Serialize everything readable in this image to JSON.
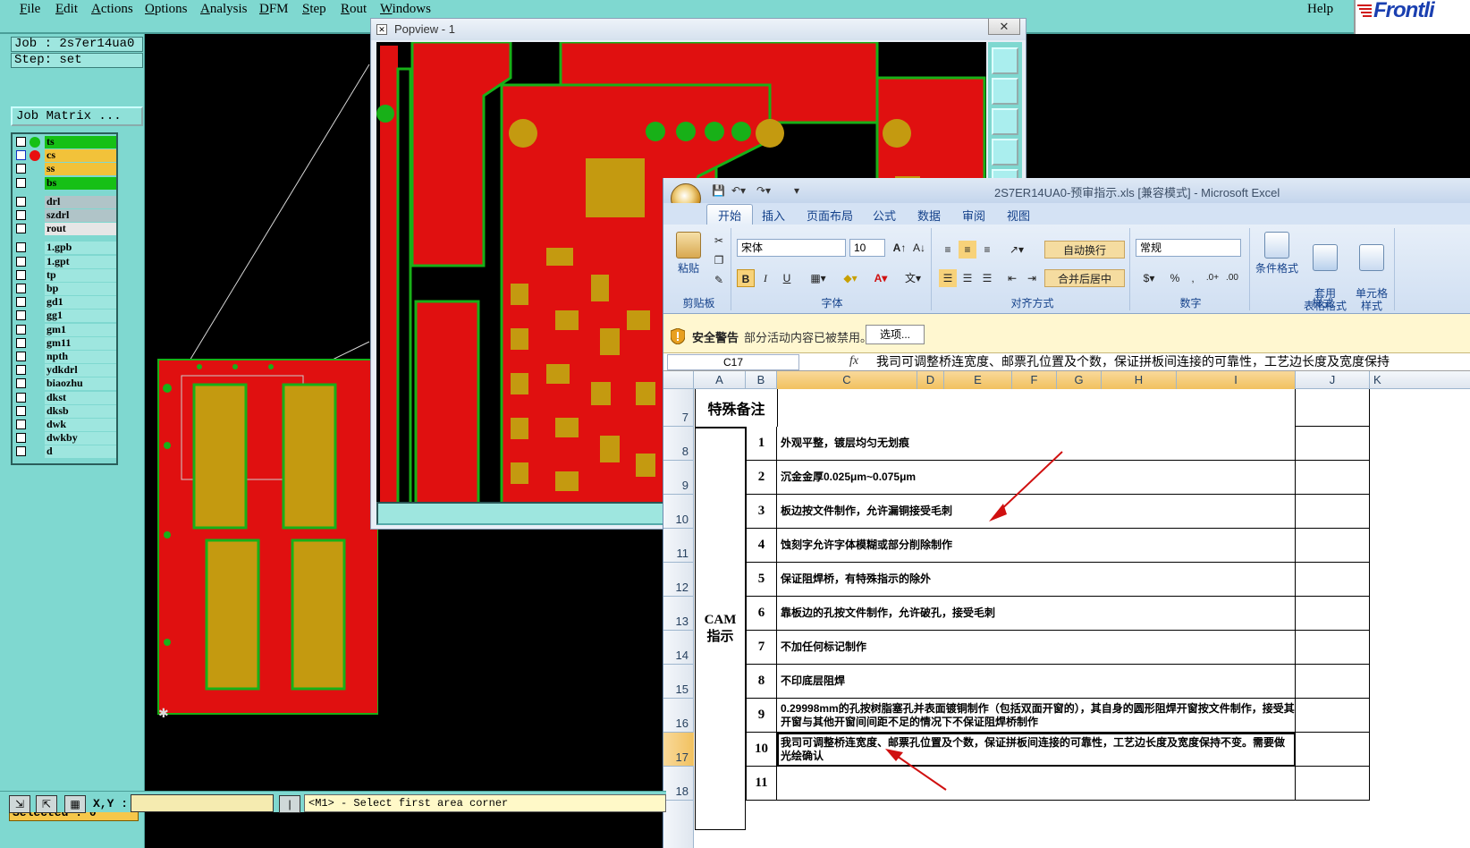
{
  "menubar": {
    "items": [
      "File",
      "Edit",
      "Actions",
      "Options",
      "Analysis",
      "DFM",
      "Step",
      "Rout",
      "Windows"
    ],
    "help": "Help",
    "logo_text": "Frontli"
  },
  "leftpanel": {
    "job": "Job : 2s7er14ua0",
    "step": "Step: set",
    "job_matrix": "Job Matrix ...",
    "layers": [
      {
        "name": "ts",
        "color": "#16c016",
        "dot": "#16c016"
      },
      {
        "name": "cs",
        "color": "#f2c23a",
        "dot": "#e81010",
        "active": true
      },
      {
        "name": "ss",
        "color": "#f2c23a"
      },
      {
        "name": "bs",
        "color": "#16c016"
      },
      {
        "name": "drl",
        "color": "#b0c4c8"
      },
      {
        "name": "szdrl",
        "color": "#b0c4c8"
      },
      {
        "name": "rout",
        "color": "#e6e6e6"
      },
      {
        "name": "1.gpb",
        "color": "#9ee6df"
      },
      {
        "name": "1.gpt",
        "color": "#9ee6df"
      },
      {
        "name": "tp",
        "color": "#9ee6df"
      },
      {
        "name": "bp",
        "color": "#9ee6df"
      },
      {
        "name": "gd1",
        "color": "#9ee6df"
      },
      {
        "name": "gg1",
        "color": "#9ee6df"
      },
      {
        "name": "gm1",
        "color": "#9ee6df"
      },
      {
        "name": "gm11",
        "color": "#9ee6df"
      },
      {
        "name": "npth",
        "color": "#9ee6df"
      },
      {
        "name": "ydkdrl",
        "color": "#9ee6df"
      },
      {
        "name": "biaozhu",
        "color": "#9ee6df"
      },
      {
        "name": "dkst",
        "color": "#9ee6df"
      },
      {
        "name": "dksb",
        "color": "#9ee6df"
      },
      {
        "name": "dwk",
        "color": "#9ee6df"
      },
      {
        "name": "dwkby",
        "color": "#9ee6df"
      },
      {
        "name": "d",
        "color": "#9ee6df"
      }
    ],
    "selected": "Selected : 0"
  },
  "statusbar": {
    "xy_label": "X,Y :",
    "message": "<M1> - Select first area corner"
  },
  "popview": {
    "title": "Popview - 1",
    "close": "✕"
  },
  "excel": {
    "caption": "2S7ER14UA0-预审指示.xls  [兼容模式] - Microsoft Excel",
    "tabs": [
      "开始",
      "插入",
      "页面布局",
      "公式",
      "数据",
      "审阅",
      "视图"
    ],
    "ribbon": {
      "paste": "粘贴",
      "clipboard": "剪贴板",
      "font_name": "宋体",
      "font_size": "10",
      "font_group": "字体",
      "wrap_text": "自动换行",
      "merge_center": "合并后居中",
      "align_group": "对齐方式",
      "number_format": "常规",
      "number_group": "数字",
      "cond_format": "条件格式",
      "table_format": "套用\n表格格式",
      "cell_style": "单元格\n样式",
      "style_group": "样式"
    },
    "security": {
      "label": "安全警告",
      "message": "部分活动内容已被禁用。",
      "options": "选项..."
    },
    "name_box": "C17",
    "formula": "我司可调整桥连宽度、邮票孔位置及个数，保证拼板间连接的可靠性，工艺边长度及宽度保持",
    "columns": [
      "A",
      "B",
      "C",
      "D",
      "E",
      "F",
      "G",
      "H",
      "I",
      "J",
      "K"
    ],
    "header_row": {
      "row": "7",
      "label": "特殊备注"
    },
    "group_label_line1": "CAM",
    "group_label_line2": "指示",
    "rows": [
      {
        "row": "8",
        "num": "1",
        "text": "外观平整，镀层均匀无划痕"
      },
      {
        "row": "9",
        "num": "2",
        "text": "沉金金厚0.025μm~0.075μm"
      },
      {
        "row": "10",
        "num": "3",
        "text": "板边按文件制作，允许漏铜接受毛刺"
      },
      {
        "row": "11",
        "num": "4",
        "text": "蚀刻字允许字体模糊或部分削除制作"
      },
      {
        "row": "12",
        "num": "5",
        "text": "保证阻焊桥，有特殊指示的除外"
      },
      {
        "row": "13",
        "num": "6",
        "text": "靠板边的孔按文件制作，允许破孔，接受毛刺"
      },
      {
        "row": "14",
        "num": "7",
        "text": "不加任何标记制作"
      },
      {
        "row": "15",
        "num": "8",
        "text": "不印底层阻焊"
      },
      {
        "row": "16",
        "num": "9",
        "text": "0.29998mm的孔按树脂塞孔并表面镀铜制作（包括双面开窗的），其自身的圆形阻焊开窗按文件制作，接受其开窗与其他开窗间间距不足的情况下不保证阻焊桥制作"
      },
      {
        "row": "17",
        "num": "10",
        "text": "我司可调整桥连宽度、邮票孔位置及个数，保证拼板间连接的可靠性，工艺边长度及宽度保持不变。需要做光绘确认"
      },
      {
        "row": "18",
        "num": "11",
        "text": ""
      }
    ]
  }
}
